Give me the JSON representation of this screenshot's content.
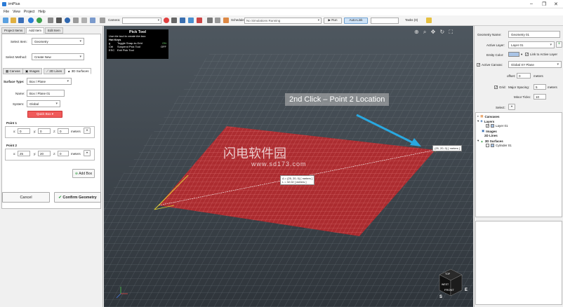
{
  "app": {
    "title": "imPlus"
  },
  "menu": [
    "File",
    "View",
    "Project",
    "Help"
  ],
  "toolbar": {
    "camera_label": "Camera:",
    "schedule_label": "Schedule:",
    "schedule_value": "No Simulations Running",
    "run_label": "Run",
    "autolink_label": "Auto-Link",
    "tasks_label": "Tasks (0)"
  },
  "left": {
    "tabs": [
      "Project Items",
      "Add Item",
      "Edit Item"
    ],
    "select_item_label": "Select Item:",
    "select_item_value": "Geometry",
    "select_method_label": "Select Method:",
    "select_method_value": "Create New",
    "subtabs": [
      "Canvas",
      "Images",
      "2D Lines",
      "3D Surfaces"
    ],
    "surface_type_label": "Surface Type:",
    "surface_type_value": "Box / Plane",
    "name_label": "Name:",
    "name_value": "Box / Plane 01",
    "system_label": "System:",
    "system_value": "Global",
    "quickbox_label": "Quick Box",
    "point1_label": "Point 1",
    "point1": {
      "x": "0",
      "y": "0",
      "z": "0"
    },
    "point2_label": "Point 2",
    "point2": {
      "x": "25",
      "y": "20",
      "z": "0"
    },
    "units": "meters",
    "addbox_label": "Add Box",
    "cancel_label": "Cancel",
    "confirm_label": "Confirm Geometry"
  },
  "viewport": {
    "tooltip": {
      "title": "Pick Tool",
      "subtitle": "Use the tool to create the box.",
      "hotkeys_title": "Hot Keys",
      "rows": [
        {
          "key": "g",
          "desc": "Toggle Snap-to-Grid",
          "state": "ON"
        },
        {
          "key": "Ctrl",
          "desc": "Suspend Pick Tool",
          "state": "OFF"
        },
        {
          "key": "ESC",
          "desc": "Exit Pick Tool",
          "state": ""
        }
      ]
    },
    "annotation": "2nd Click – Point 2 Location",
    "coord_point2": "(25, 20, 0) [ meters ]",
    "delta_line1": "Δ = (25, 20, 0) [ meters ]",
    "delta_line2": "L = 32.02 [ meters ]",
    "watermark_cn": "闪电软件园",
    "watermark_url": "www.sd173.com",
    "cube": {
      "top": "TOP",
      "front": "FRONT",
      "left": "WEST",
      "bottom": "S",
      "right": "E"
    }
  },
  "right": {
    "geometry_name_label": "Geometry Name:",
    "geometry_name_value": "Geometry 01",
    "active_layer_label": "Active Layer:",
    "active_layer_value": "Layer 01",
    "entity_color_label": "Entity Color:",
    "link_label": "Link to Active Layer",
    "active_canvas_label": "Active Canvas:",
    "active_canvas_value": "Global XY Plane",
    "offset_label": "offset:",
    "offset_value": "0",
    "units": "meters",
    "grid_label": "Grid:",
    "major_spacing_label": "Major Spacing:",
    "major_spacing_value": "5",
    "minor_ticks_label": "Minor Ticks:",
    "minor_ticks_value": "10",
    "select_label": "Select:",
    "tree": {
      "canvases": "Canvases",
      "layers": "Layers",
      "layer01": "Layer 01",
      "images": "Images",
      "lines": "2D Lines",
      "surfaces": "3D Surfaces",
      "cylinder": "Cylinder 01"
    }
  },
  "colors": {
    "accent": "#2b7bd6",
    "box_fill": "#c0282c",
    "annotation_arrow": "#29a8e0",
    "quickbox": "#f05a5a"
  }
}
